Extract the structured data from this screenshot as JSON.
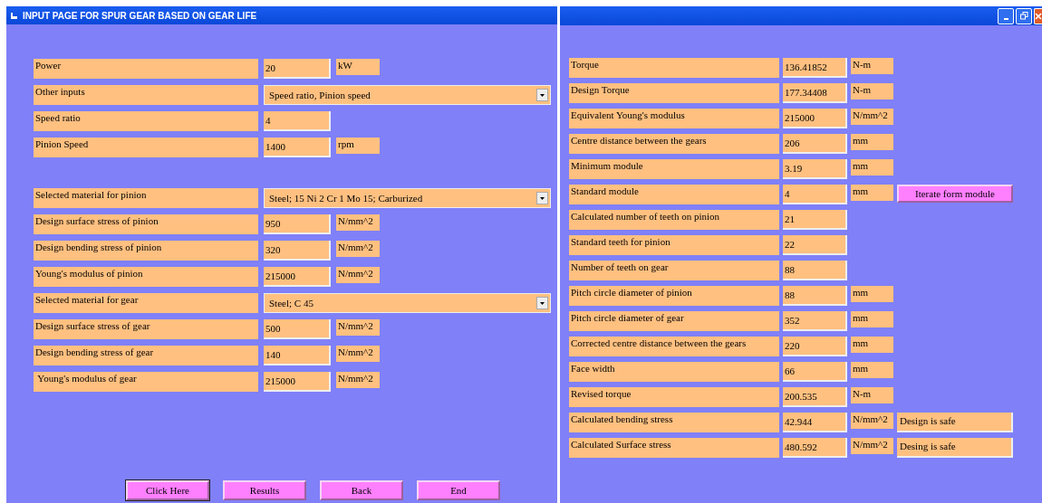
{
  "input_window": {
    "title": "INPUT PAGE FOR SPUR GEAR BASED ON GEAR LIFE",
    "groups": [
      {
        "rows": [
          {
            "kind": "field",
            "label": "Power",
            "value": "20",
            "unit": "kW"
          },
          {
            "kind": "dropdown",
            "label": "Other inputs",
            "value": "Speed ratio, Pinion speed"
          },
          {
            "kind": "field",
            "label": "Speed ratio",
            "value": "4"
          },
          {
            "kind": "field",
            "label": "Pinion Speed",
            "value": "1400",
            "unit": "rpm"
          }
        ]
      },
      {
        "rows": [
          {
            "kind": "dropdown",
            "label": "Selected material for pinion",
            "value": "Steel; 15 Ni 2 Cr 1 Mo 15; Carburized"
          },
          {
            "kind": "field",
            "label": "Design surface stress of pinion",
            "value": "950",
            "unit": "N/mm^2"
          },
          {
            "kind": "field",
            "label": "Design bending stress of pinion",
            "value": "320",
            "unit": "N/mm^2"
          },
          {
            "kind": "field",
            "label": "Young's modulus of pinion",
            "value": "215000",
            "unit": "N/mm^2"
          },
          {
            "kind": "dropdown",
            "label": "Selected material for gear",
            "value": "Steel; C 45"
          },
          {
            "kind": "field",
            "label": "Design surface stress of gear",
            "value": "500",
            "unit": "N/mm^2"
          },
          {
            "kind": "field",
            "label": "Design bending stress of gear",
            "value": "140",
            "unit": "N/mm^2"
          },
          {
            "kind": "field",
            "label": " Young's modulus of gear",
            "value": "215000",
            "unit": "N/mm^2"
          }
        ]
      }
    ],
    "buttons": [
      {
        "label": "Click Here",
        "focused": true
      },
      {
        "label": "Results",
        "focused": false
      },
      {
        "label": "Back",
        "focused": false
      },
      {
        "label": "End",
        "focused": false
      }
    ]
  },
  "results_window": {
    "rows": [
      {
        "label": "Torque",
        "value": "136.41852",
        "unit": "N-m"
      },
      {
        "label": "Design Torque",
        "value": "177.34408",
        "unit": "N-m"
      },
      {
        "label": "Equivalent Young's modulus",
        "value": "215000",
        "unit": "N/mm^2"
      },
      {
        "label": "Centre distance between the gears",
        "value": "206",
        "unit": "mm"
      },
      {
        "label": "Minimum module",
        "value": "3.19",
        "unit": "mm"
      },
      {
        "label": "Standard module",
        "value": "4",
        "unit": "mm",
        "extra": {
          "kind": "button",
          "text": "Iterate form module"
        }
      },
      {
        "label": "Calculated number of teeth on pinion",
        "value": "21"
      },
      {
        "label": "Standard teeth for pinion",
        "value": "22"
      },
      {
        "label": "Number of teeth on gear",
        "value": "88"
      },
      {
        "label": "Pitch circle diameter of pinion",
        "value": "88",
        "unit": "mm"
      },
      {
        "label": "Pitch circle diameter of gear",
        "value": "352",
        "unit": "mm"
      },
      {
        "label": "Corrected centre distance between the gears",
        "value": "220",
        "unit": "mm"
      },
      {
        "label": "Face width",
        "value": "66",
        "unit": "mm"
      },
      {
        "label": "Revised torque",
        "value": "200.535",
        "unit": "N-m"
      },
      {
        "label": "Calculated bending stress",
        "value": "42.944",
        "unit": "N/mm^2",
        "extra": {
          "kind": "status",
          "text": "Design is safe"
        }
      },
      {
        "label": "Calculated Surface stress",
        "value": "480.592",
        "unit": "N/mm^2",
        "extra": {
          "kind": "status",
          "text": "Desing is safe"
        }
      }
    ]
  }
}
